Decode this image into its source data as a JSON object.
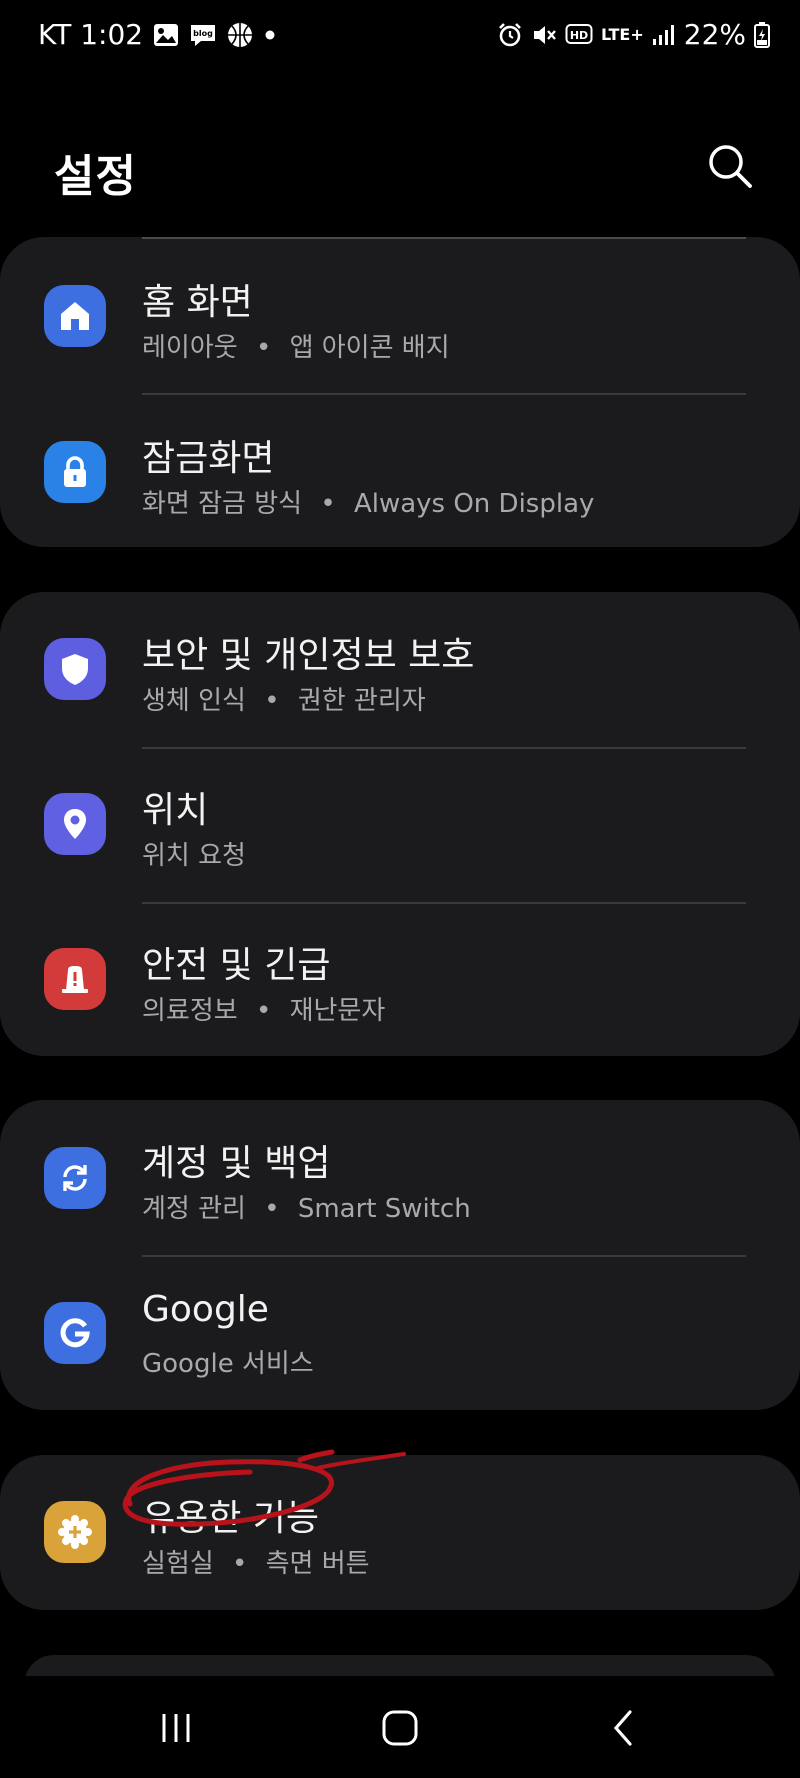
{
  "status_bar": {
    "carrier_time": "KT 1:02",
    "network": "LTE+",
    "battery": "22%",
    "icons": [
      "gallery-icon",
      "blog-icon",
      "basketball-icon",
      "dot-icon",
      "alarm-icon",
      "mute-icon",
      "hd-icon",
      "signal-icon",
      "battery-icon"
    ]
  },
  "header": {
    "title": "설정",
    "search_icon": "search-icon"
  },
  "groups": [
    {
      "items": [
        {
          "title": "홈 화면",
          "subtitle_a": "레이아웃",
          "subtitle_b": "앱 아이콘 배지",
          "icon": "home-icon",
          "color": "#3e6fe0"
        },
        {
          "title": "잠금화면",
          "subtitle_a": "화면 잠금 방식",
          "subtitle_b": "Always On Display",
          "icon": "lock-icon",
          "color": "#2b82e6"
        }
      ]
    },
    {
      "items": [
        {
          "title": "보안 및 개인정보 보호",
          "subtitle_a": "생체 인식",
          "subtitle_b": "권한 관리자",
          "icon": "shield-icon",
          "color": "#5d5ee0"
        },
        {
          "title": "위치",
          "subtitle_a": "위치 요청",
          "subtitle_b": "",
          "icon": "location-pin-icon",
          "color": "#5f60e2"
        },
        {
          "title": "안전 및 긴급",
          "subtitle_a": "의료정보",
          "subtitle_b": "재난문자",
          "icon": "emergency-icon",
          "color": "#d33a3a"
        }
      ]
    },
    {
      "items": [
        {
          "title": "계정 및 백업",
          "subtitle_a": "계정 관리",
          "subtitle_b": "Smart Switch",
          "icon": "sync-icon",
          "color": "#3e6fe0"
        },
        {
          "title": "Google",
          "subtitle_a": "Google 서비스",
          "subtitle_b": "",
          "icon": "google-icon",
          "color": "#3e6fe0"
        }
      ]
    },
    {
      "items": [
        {
          "title": "유용한 기능",
          "subtitle_a": "실험실",
          "subtitle_b": "측면 버튼",
          "icon": "advanced-features-icon",
          "color": "#d9a33a"
        }
      ]
    }
  ],
  "separator": "•",
  "nav": {
    "recents_icon": "recents-icon",
    "home_icon": "home-button-icon",
    "back_icon": "back-icon"
  }
}
